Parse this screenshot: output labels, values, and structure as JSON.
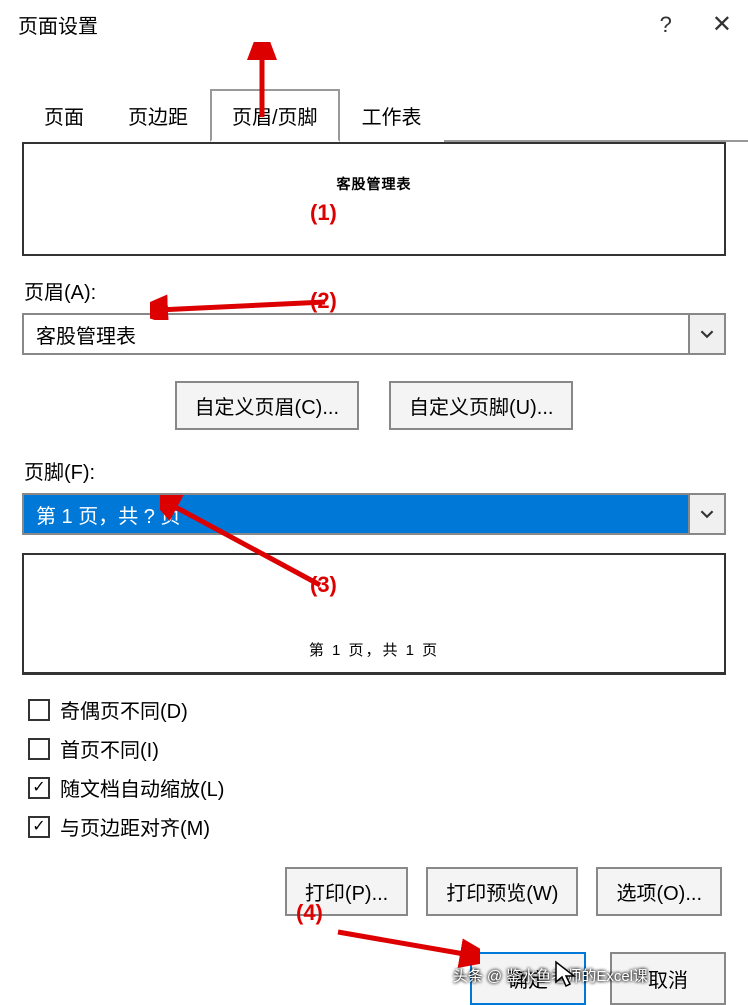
{
  "title": "页面设置",
  "tabs": [
    "页面",
    "页边距",
    "页眉/页脚",
    "工作表"
  ],
  "active_tab": 2,
  "preview_header": "客股管理表",
  "header_label": "页眉(A):",
  "header_value": "客股管理表",
  "custom_header_btn": "自定义页眉(C)...",
  "custom_footer_btn": "自定义页脚(U)...",
  "footer_label": "页脚(F):",
  "footer_value": "第 1 页，共 ? 页",
  "preview_footer": "第 1 页，共 1 页",
  "checks": [
    {
      "label": "奇偶页不同(D)",
      "checked": false
    },
    {
      "label": "首页不同(I)",
      "checked": false
    },
    {
      "label": "随文档自动缩放(L)",
      "checked": true
    },
    {
      "label": "与页边距对齐(M)",
      "checked": true
    }
  ],
  "print_btn": "打印(P)...",
  "preview_btn": "打印预览(W)",
  "options_btn": "选项(O)...",
  "ok_btn": "确定",
  "cancel_btn": "取消",
  "annotations": {
    "a1": "(1)",
    "a2": "(2)",
    "a3": "(3)",
    "a4": "(4)"
  },
  "watermark": "头条 @ 鉴水鱼老师的Excel课"
}
